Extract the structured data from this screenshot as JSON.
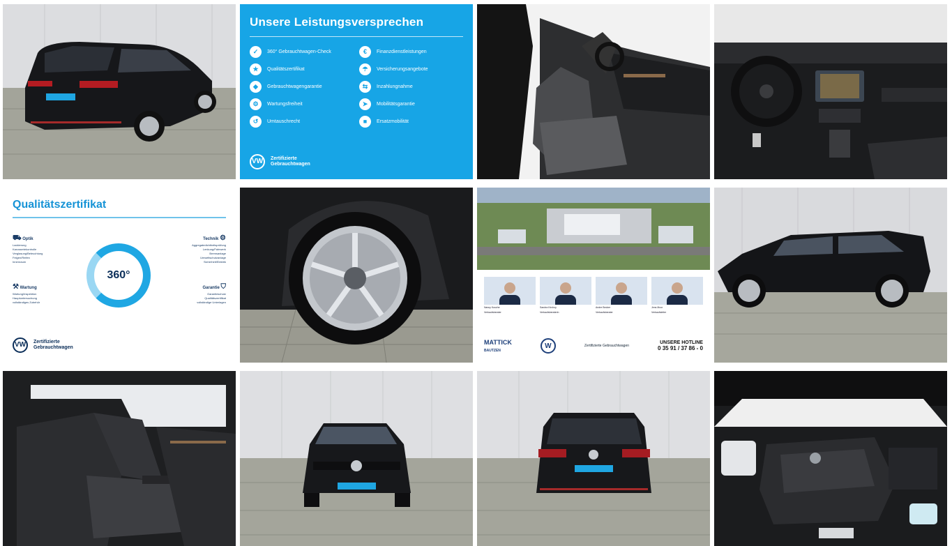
{
  "gallery": {
    "tiles": [
      {
        "name": "rear-three-quarter-photo",
        "desc": "Rear view of black station wagon"
      },
      {
        "name": "service-promise-panel"
      },
      {
        "name": "front-seats-photo"
      },
      {
        "name": "cockpit-photo"
      },
      {
        "name": "quality-certificate-panel"
      },
      {
        "name": "wheel-photo"
      },
      {
        "name": "dealer-panel"
      },
      {
        "name": "side-profile-photo"
      },
      {
        "name": "rear-seats-photo"
      },
      {
        "name": "front-view-photo"
      },
      {
        "name": "rear-view-photo"
      },
      {
        "name": "engine-bay-photo"
      }
    ]
  },
  "promise": {
    "title": "Unsere Leistungsversprechen",
    "left": [
      "360° Gebrauchtwagen-Check",
      "Qualitätszertifikat",
      "Gebrauchtwagengarantie",
      "Wartungsfreiheit",
      "Umtauschrecht"
    ],
    "right": [
      "Finanzdienstleistungen",
      "Versicherungsangebote",
      "Inzahlungnahme",
      "Mobilitätsgarantie",
      "Ersatzmobilität"
    ],
    "footer_line1": "Zertifizierte",
    "footer_line2": "Gebrauchtwagen",
    "logo_text": "VW"
  },
  "cert": {
    "title": "Qualitätszertifikat",
    "center": "360°",
    "optik": {
      "heading": "Optik",
      "items": [
        "Lackierung",
        "Karosseriekontrolle",
        "Verglasung/Beleuchtung",
        "Felgen/Reifen",
        "Innenraum"
      ]
    },
    "technik": {
      "heading": "Technik",
      "items": [
        "Aggregatedichtheitsprüfung",
        "Lenkung/Fahrwerk",
        "Bremsanlage",
        "Umweltschutzanlage",
        "Sicherheit/Elektrik"
      ]
    },
    "wartung": {
      "heading": "Wartung",
      "items": [
        "Wartung/Inspektion",
        "Hauptuntersuchung",
        "vollständiges Zubehör"
      ]
    },
    "garantie": {
      "heading": "Garantie",
      "items": [
        "Garantieschutz",
        "Qualitätszertifikat",
        "vollständige Unterlagen"
      ]
    },
    "footer_line1": "Zertifizierte",
    "footer_line2": "Gebrauchtwagen",
    "logo_text": "VW"
  },
  "dealer": {
    "people": [
      {
        "name": "Nancy Kusche",
        "role": "Verkaufsberater"
      },
      {
        "name": "Sandra Kirchoy",
        "role": "Verkaufsberaterin"
      },
      {
        "name": "Andre Becker",
        "role": "Verkaufsberater"
      },
      {
        "name": "Jens Moor",
        "role": "Verkaufsleiter"
      }
    ],
    "brand": "MATTICK",
    "city": "BAUTZEN",
    "hotline_label": "UNSERE HOTLINE",
    "hotline_number": "0 35 91 / 37 86 - 0",
    "cert_text": "Zertifizierte Gebrauchtwagen"
  }
}
